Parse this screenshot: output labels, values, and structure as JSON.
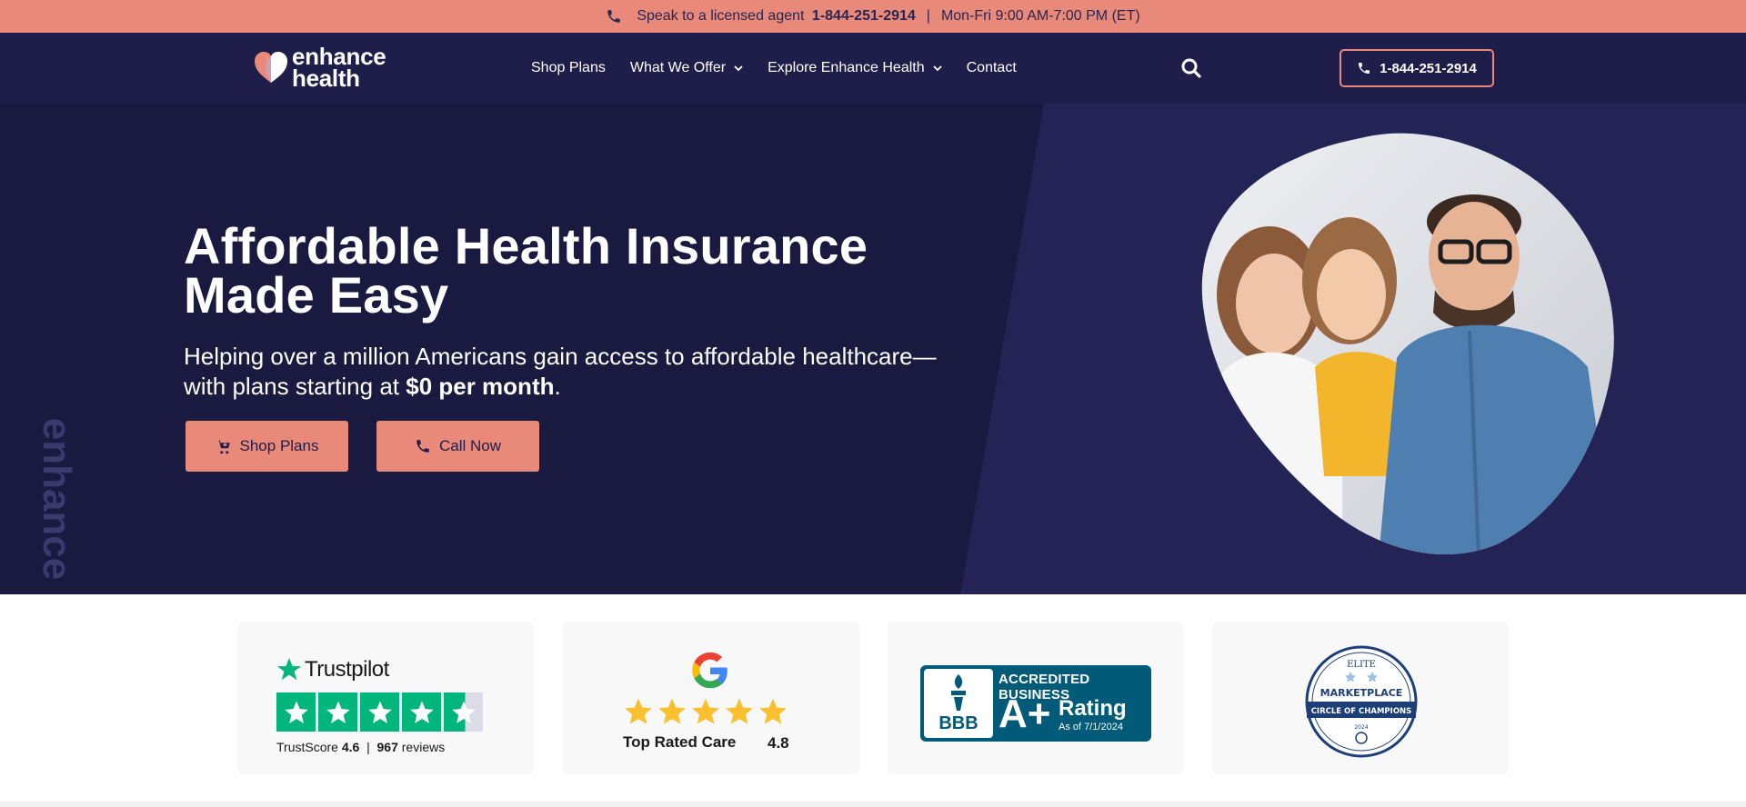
{
  "topbar": {
    "agent_text": "Speak to a licensed agent",
    "phone": "1-844-251-2914",
    "separator": "|",
    "hours": "Mon-Fri 9:00 AM-7:00 PM (ET)"
  },
  "nav": {
    "logo_line1": "enhance",
    "logo_line2": "health",
    "links": [
      {
        "label": "Shop Plans"
      },
      {
        "label": "What We Offer"
      },
      {
        "label": "Explore Enhance Health"
      },
      {
        "label": "Contact"
      }
    ],
    "call_button": "1-844-251-2914",
    "icons": {
      "search": "search-icon",
      "phone": "phone-icon"
    }
  },
  "hero": {
    "watermark": "enhance",
    "title_line1": "Affordable Health Insurance",
    "title_line2": "Made Easy",
    "sub_part1": "Helping over a million Americans gain access to affordable healthcare—",
    "sub_part2": "with plans starting at ",
    "sub_bold": "$0 per month",
    "sub_end": ".",
    "shop_button": "Shop Plans",
    "call_button": "Call Now"
  },
  "badges": {
    "trustpilot": {
      "name": "Trustpilot",
      "score_label": "TrustScore",
      "score": "4.6",
      "separator": "|",
      "reviews": "967",
      "reviews_label": "reviews",
      "stars": 4.6
    },
    "google": {
      "label": "Top Rated Care",
      "score": "4.8",
      "stars": 5
    },
    "bbb": {
      "accredited": "ACCREDITED BUSINESS",
      "grade": "A+",
      "rating": "Rating",
      "as_of": "As of 7/1/2024",
      "bbb": "BBB"
    },
    "elite": {
      "top": "ELITE",
      "middle": "MARKETPLACE",
      "band": "CIRCLE OF CHAMPIONS",
      "year": "2024"
    }
  },
  "colors": {
    "coral": "#e8897a",
    "navy": "#1f1d4a",
    "hero_dark": "#1a1940",
    "trustpilot_green": "#00b67a",
    "bbb_blue": "#005a78"
  }
}
